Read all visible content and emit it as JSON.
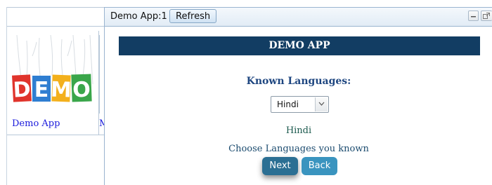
{
  "left_pane": {
    "apps": [
      {
        "caption": "Demo App",
        "thumb_icon": "demo-tags-image"
      },
      {
        "caption": "M"
      }
    ]
  },
  "window": {
    "title": "Demo App:1",
    "refresh_label": "Refresh",
    "controls": [
      "minimize-icon",
      "popout-icon"
    ]
  },
  "form": {
    "header": "DEMO APP",
    "known_label": "Known Languages:",
    "language_select": {
      "selected": "Hindi"
    },
    "selected_text": "Hindi",
    "choose_label": "Choose Languages you known",
    "next_label": "Next",
    "back_label": "Back"
  },
  "colors": {
    "header_bg": "#123d63",
    "label_blue": "#1e4680",
    "next_btn": "#2b6f93",
    "back_btn": "#3a94bf",
    "link": "#1a1adc"
  }
}
